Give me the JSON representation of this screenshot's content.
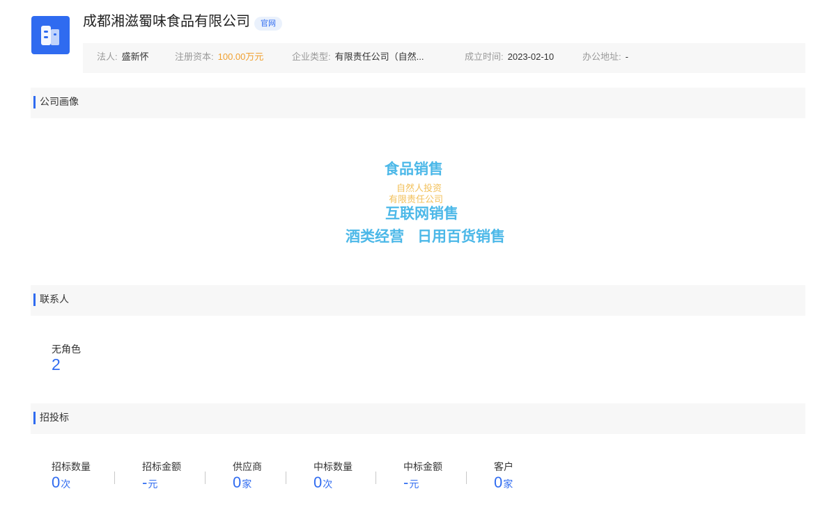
{
  "header": {
    "logo_icon": "building-icon",
    "company_name": "成都湘滋蜀味食品有限公司",
    "site_badge": "官网",
    "accent_color": "#2f6bf0"
  },
  "info": {
    "legal_rep_label": "法人:",
    "legal_rep_value": "盛新怀",
    "reg_capital_label": "注册资本:",
    "reg_capital_value": "100.00万元",
    "company_type_label": "企业类型:",
    "company_type_value": "有限责任公司（自然...",
    "established_label": "成立时间:",
    "established_value": "2023-02-10",
    "office_label": "办公地址:",
    "office_value": "-"
  },
  "portrait": {
    "title": "公司画像",
    "words": [
      "食品销售",
      "自然人投资",
      "有限责任公司",
      "互联网销售",
      "酒类经营",
      "日用百货销售"
    ]
  },
  "contacts": {
    "title": "联系人",
    "role_label": "无角色",
    "role_count": "2"
  },
  "bidding": {
    "title": "招投标",
    "stats": [
      {
        "label": "招标数量",
        "value": "0",
        "unit": "次"
      },
      {
        "label": "招标金额",
        "value": "-",
        "unit": "元"
      },
      {
        "label": "供应商",
        "value": "0",
        "unit": "家"
      },
      {
        "label": "中标数量",
        "value": "0",
        "unit": "次"
      },
      {
        "label": "中标金额",
        "value": "-",
        "unit": "元"
      },
      {
        "label": "客户",
        "value": "0",
        "unit": "家"
      }
    ]
  }
}
